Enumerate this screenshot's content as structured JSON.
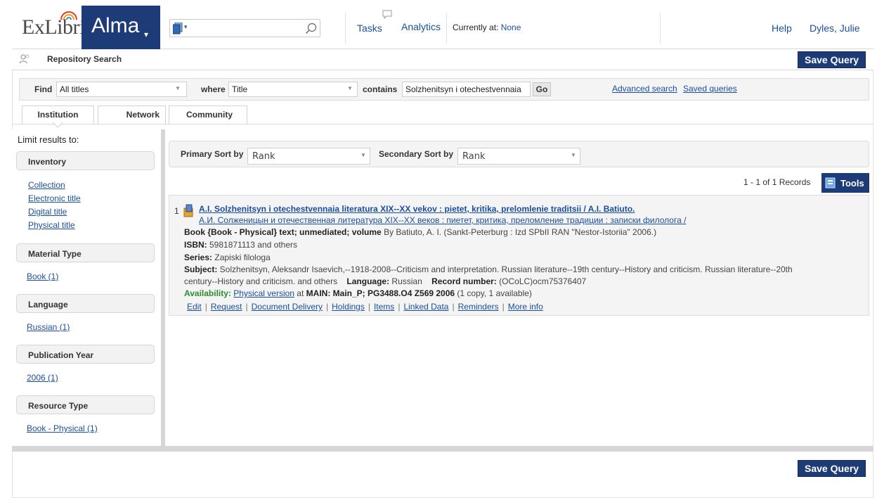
{
  "header": {
    "logo_ex": "ExLibris",
    "app_name": "Alma",
    "tasks": "Tasks",
    "analytics": "Analytics",
    "currently_at_label": "Currently at:",
    "currently_at_value": "None",
    "help": "Help",
    "user": "Dyles, Julie"
  },
  "page": {
    "title": "Repository Search",
    "save_query": "Save Query"
  },
  "find": {
    "find_label": "Find",
    "find_value": "All titles",
    "where_label": "where",
    "where_value": "Title",
    "contains_label": "contains",
    "query": "Solzhenitsyn i otechestvennaia",
    "go": "Go",
    "advanced": "Advanced search",
    "saved": "Saved queries"
  },
  "tabs": [
    "Institution",
    "Network",
    "Community"
  ],
  "sidebar": {
    "limit_label": "Limit results to:",
    "facets": [
      {
        "title": "Inventory",
        "links": [
          "Collection",
          "Electronic title",
          "Digital title",
          "Physical title"
        ]
      },
      {
        "title": "Material Type",
        "links": [
          "Book (1)"
        ]
      },
      {
        "title": "Language",
        "links": [
          "Russian (1)"
        ]
      },
      {
        "title": "Publication Year",
        "links": [
          "2006 (1)"
        ]
      },
      {
        "title": "Resource Type",
        "links": [
          "Book - Physical (1)"
        ]
      }
    ]
  },
  "sort": {
    "primary_label": "Primary Sort by",
    "primary_value": "Rank",
    "secondary_label": "Secondary Sort by",
    "secondary_value": "Rank"
  },
  "results": {
    "count": "1 - 1 of 1 Records",
    "tools": "Tools",
    "items": [
      {
        "num": "1",
        "title": "A.I. Solzhenitsyn i otechestvennaia literatura XIX--XX vekov : pietet, kritika, prelomlenie traditsii / A.I. Batiuto.",
        "alt_title": "А.И. Солженицын и отечественная литература XIX--XX веков : пиетет, критика, преломление традиции : записки филолога /",
        "format_bold": "Book {Book - Physical} text; unmediated; volume",
        "by_text": " By Batiuto, A. I. (Sankt-Peterburg : Izd SPbII RAN \"Nestor-Istoriia\" 2006.)",
        "isbn_label": "ISBN:",
        "isbn_value": " 5981871113 and others",
        "series_label": "Series:",
        "series_value": " Zapiski filologa",
        "subject_label": "Subject:",
        "subject_value": " Solzhenitsyn, Aleksandr Isaevich,--1918-2008--Criticism and interpretation. Russian literature--19th century--History and criticism. Russian literature--20th",
        "subject_value2": "century--History and criticism. and others",
        "language_label": "Language:",
        "language_value": " Russian",
        "record_label": "Record number:",
        "record_value": " (OCoLC)ocm75376407",
        "availability_label": "Availability:",
        "availability_link": "Physical version",
        "availability_at": " at ",
        "availability_loc": "MAIN: Main_P; PG3488.O4 Z569 2006",
        "availability_rest": " (1 copy, 1 available)",
        "actions": [
          "Edit",
          "Request",
          "Document Delivery",
          "Holdings",
          "Items",
          "Linked Data",
          "Reminders",
          "More info"
        ]
      }
    ]
  },
  "colors": {
    "brand": "#1d3b76",
    "link": "#1a4e9e",
    "availability": "#2e8b2e"
  }
}
